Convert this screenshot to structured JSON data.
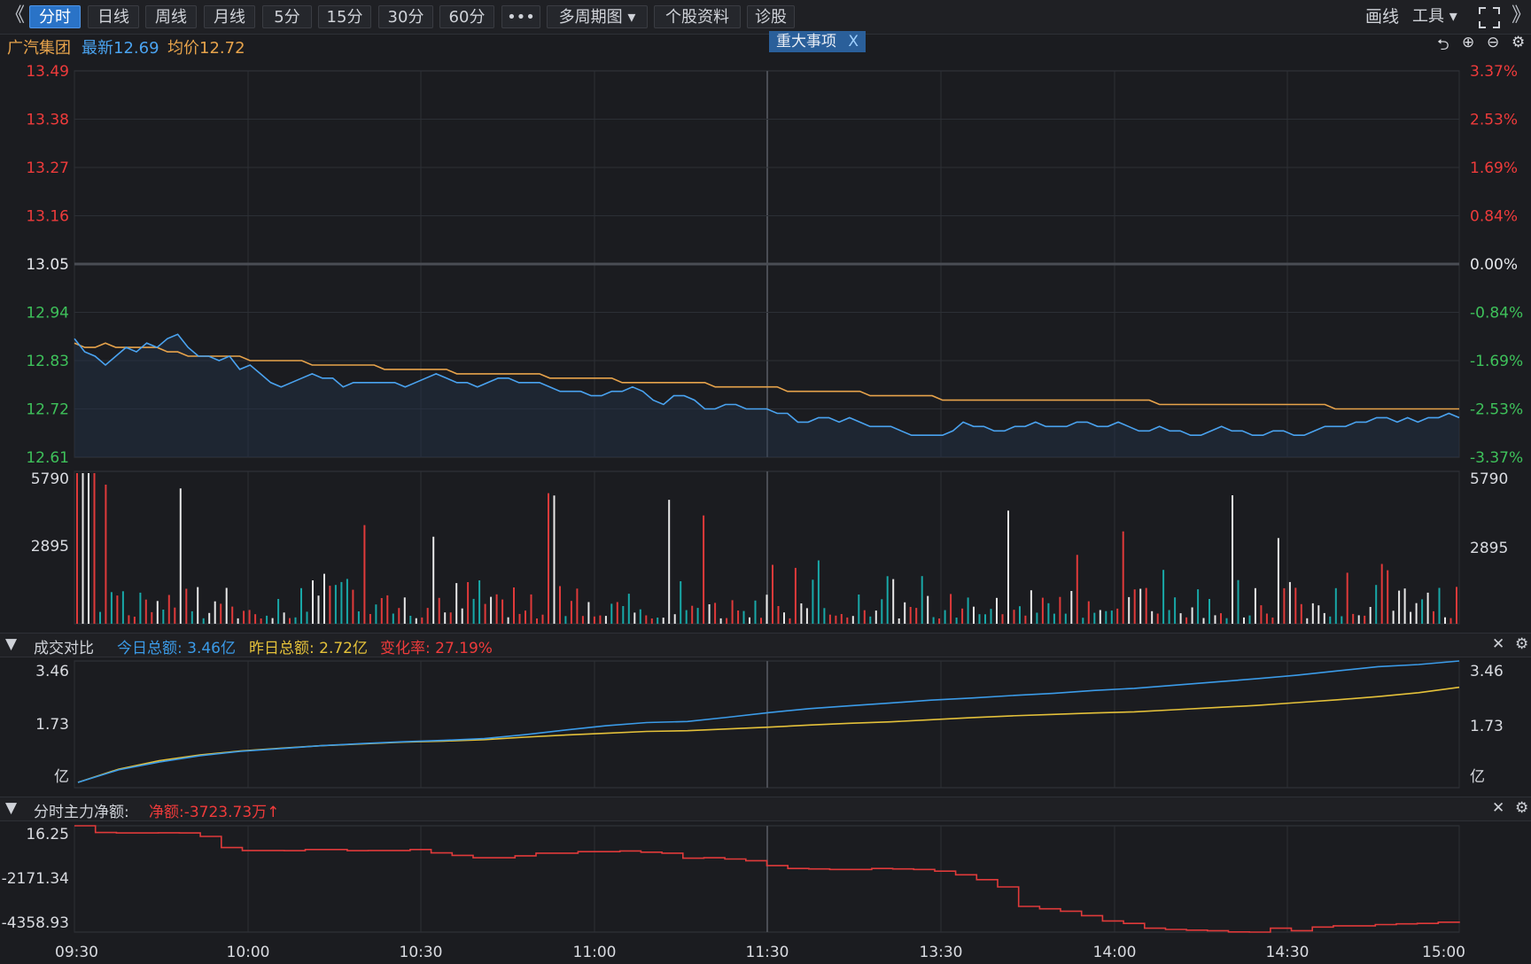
{
  "toolbar": {
    "left_arrow": "《",
    "right_arrow": "》",
    "tabs": [
      {
        "label": "分时",
        "active": true
      },
      {
        "label": "日线"
      },
      {
        "label": "周线"
      },
      {
        "label": "月线"
      },
      {
        "label": "5分"
      },
      {
        "label": "15分"
      },
      {
        "label": "30分"
      },
      {
        "label": "60分"
      },
      {
        "label": "•••"
      },
      {
        "label": "多周期图 ▾"
      },
      {
        "label": "个股资料"
      },
      {
        "label": "诊股"
      }
    ],
    "draw_label": "画线",
    "tools_label": "工具 ▾",
    "fullscreen_icon": "expand-icon"
  },
  "info": {
    "stock_name": "广汽集团",
    "latest": "最新12.69",
    "avg": "均价12.72",
    "event_badge": "重大事项",
    "event_close": "X"
  },
  "colors": {
    "up": "#ee3b3b",
    "down": "#3ec15a",
    "price_line": "#4aa3f0",
    "avg_line": "#e7a34b",
    "today": "#3b9be8",
    "yesterday": "#e4c13a",
    "netflow": "#e03a3a"
  },
  "chart_data": [
    {
      "type": "line",
      "name": "price",
      "y_left_ticks": [
        "13.49",
        "13.38",
        "13.27",
        "13.16",
        "13.05",
        "12.94",
        "12.83",
        "12.72",
        "12.61"
      ],
      "y_right_ticks": [
        "3.37%",
        "2.53%",
        "1.69%",
        "0.84%",
        "0.00%",
        "-0.84%",
        "-1.69%",
        "-2.53%",
        "-3.37%"
      ],
      "ylim": [
        12.61,
        13.49
      ],
      "x_ticks": [
        "09:30",
        "10:00",
        "10:30",
        "11:00",
        "11:30",
        "13:30",
        "14:00",
        "14:30",
        "15:00"
      ],
      "price": [
        12.88,
        12.85,
        12.84,
        12.82,
        12.84,
        12.86,
        12.85,
        12.87,
        12.86,
        12.88,
        12.89,
        12.86,
        12.84,
        12.84,
        12.83,
        12.84,
        12.81,
        12.82,
        12.8,
        12.78,
        12.77,
        12.78,
        12.79,
        12.8,
        12.79,
        12.79,
        12.77,
        12.78,
        12.78,
        12.78,
        12.78,
        12.78,
        12.77,
        12.78,
        12.79,
        12.8,
        12.79,
        12.78,
        12.78,
        12.77,
        12.78,
        12.79,
        12.79,
        12.78,
        12.78,
        12.78,
        12.77,
        12.76,
        12.76,
        12.76,
        12.75,
        12.75,
        12.76,
        12.76,
        12.77,
        12.76,
        12.74,
        12.73,
        12.75,
        12.75,
        12.74,
        12.72,
        12.72,
        12.73,
        12.73,
        12.72,
        12.72,
        12.72,
        12.71,
        12.71,
        12.69,
        12.69,
        12.7,
        12.7,
        12.69,
        12.7,
        12.69,
        12.68,
        12.68,
        12.68,
        12.67,
        12.66,
        12.66,
        12.66,
        12.66,
        12.67,
        12.69,
        12.68,
        12.68,
        12.67,
        12.67,
        12.68,
        12.68,
        12.69,
        12.68,
        12.68,
        12.68,
        12.69,
        12.69,
        12.68,
        12.68,
        12.69,
        12.68,
        12.67,
        12.67,
        12.68,
        12.67,
        12.67,
        12.66,
        12.66,
        12.67,
        12.68,
        12.67,
        12.67,
        12.66,
        12.66,
        12.67,
        12.67,
        12.66,
        12.66,
        12.67,
        12.68,
        12.68,
        12.68,
        12.69,
        12.69,
        12.7,
        12.7,
        12.69,
        12.7,
        12.69,
        12.7,
        12.7,
        12.71,
        12.7
      ],
      "avg": [
        12.87,
        12.86,
        12.86,
        12.87,
        12.86,
        12.86,
        12.86,
        12.86,
        12.86,
        12.85,
        12.85,
        12.84,
        12.84,
        12.84,
        12.84,
        12.84,
        12.84,
        12.83,
        12.83,
        12.83,
        12.83,
        12.83,
        12.83,
        12.82,
        12.82,
        12.82,
        12.82,
        12.82,
        12.82,
        12.82,
        12.81,
        12.81,
        12.81,
        12.81,
        12.81,
        12.81,
        12.81,
        12.8,
        12.8,
        12.8,
        12.8,
        12.8,
        12.8,
        12.8,
        12.8,
        12.8,
        12.79,
        12.79,
        12.79,
        12.79,
        12.79,
        12.79,
        12.79,
        12.78,
        12.78,
        12.78,
        12.78,
        12.78,
        12.78,
        12.78,
        12.78,
        12.78,
        12.77,
        12.77,
        12.77,
        12.77,
        12.77,
        12.77,
        12.77,
        12.76,
        12.76,
        12.76,
        12.76,
        12.76,
        12.76,
        12.76,
        12.76,
        12.75,
        12.75,
        12.75,
        12.75,
        12.75,
        12.75,
        12.75,
        12.74,
        12.74,
        12.74,
        12.74,
        12.74,
        12.74,
        12.74,
        12.74,
        12.74,
        12.74,
        12.74,
        12.74,
        12.74,
        12.74,
        12.74,
        12.74,
        12.74,
        12.74,
        12.74,
        12.74,
        12.74,
        12.73,
        12.73,
        12.73,
        12.73,
        12.73,
        12.73,
        12.73,
        12.73,
        12.73,
        12.73,
        12.73,
        12.73,
        12.73,
        12.73,
        12.73,
        12.73,
        12.73,
        12.72,
        12.72,
        12.72,
        12.72,
        12.72,
        12.72,
        12.72,
        12.72,
        12.72,
        12.72,
        12.72,
        12.72,
        12.72
      ]
    },
    {
      "type": "bar",
      "name": "volume",
      "y_ticks": [
        "5790",
        "2895"
      ],
      "ylim": [
        0,
        5790
      ]
    },
    {
      "type": "line",
      "name": "turnover-compare",
      "y_ticks": [
        "3.46",
        "1.73",
        "亿"
      ],
      "ylim": [
        0,
        3.46
      ],
      "today": [
        0.05,
        0.4,
        0.62,
        0.8,
        0.92,
        1.0,
        1.08,
        1.14,
        1.19,
        1.23,
        1.28,
        1.39,
        1.52,
        1.64,
        1.73,
        1.76,
        1.88,
        2.01,
        2.12,
        2.2,
        2.28,
        2.36,
        2.42,
        2.49,
        2.55,
        2.63,
        2.69,
        2.78,
        2.87,
        2.96,
        3.06,
        3.18,
        3.3,
        3.36,
        3.46
      ],
      "yesterday": [
        0.05,
        0.42,
        0.66,
        0.82,
        0.93,
        1.01,
        1.08,
        1.13,
        1.18,
        1.21,
        1.25,
        1.32,
        1.38,
        1.43,
        1.48,
        1.5,
        1.55,
        1.6,
        1.66,
        1.71,
        1.75,
        1.81,
        1.87,
        1.92,
        1.96,
        2.0,
        2.03,
        2.09,
        2.15,
        2.21,
        2.29,
        2.37,
        2.46,
        2.57,
        2.72
      ],
      "labels": {
        "title": "成交对比",
        "today": "今日总额: 3.46亿",
        "yesterday": "昨日总额: 2.72亿",
        "change": "变化率: 27.19%"
      }
    },
    {
      "type": "line",
      "name": "main-netflow",
      "y_ticks": [
        "16.25",
        "-2171.34",
        "-4358.93"
      ],
      "ylim": [
        -4358.93,
        16.25
      ],
      "values": [
        16,
        -260,
        -280,
        -280,
        -270,
        -280,
        -420,
        -880,
        -1000,
        -1000,
        -1010,
        -960,
        -960,
        -1010,
        -1000,
        -1000,
        -960,
        -1100,
        -1200,
        -1300,
        -1300,
        -1220,
        -1110,
        -1110,
        -1050,
        -1050,
        -1020,
        -1070,
        -1110,
        -1320,
        -1300,
        -1350,
        -1420,
        -1620,
        -1740,
        -1760,
        -1780,
        -1780,
        -1740,
        -1760,
        -1780,
        -1850,
        -2000,
        -2200,
        -2500,
        -3300,
        -3400,
        -3500,
        -3680,
        -3900,
        -4000,
        -4200,
        -4250,
        -4280,
        -4300,
        -4350,
        -4358,
        -4200,
        -4300,
        -4150,
        -4100,
        -4100,
        -4050,
        -4020,
        -4000,
        -3950,
        -3920
      ],
      "labels": {
        "title": "分时主力净额:",
        "net": "净额:-3723.73万"
      }
    }
  ]
}
